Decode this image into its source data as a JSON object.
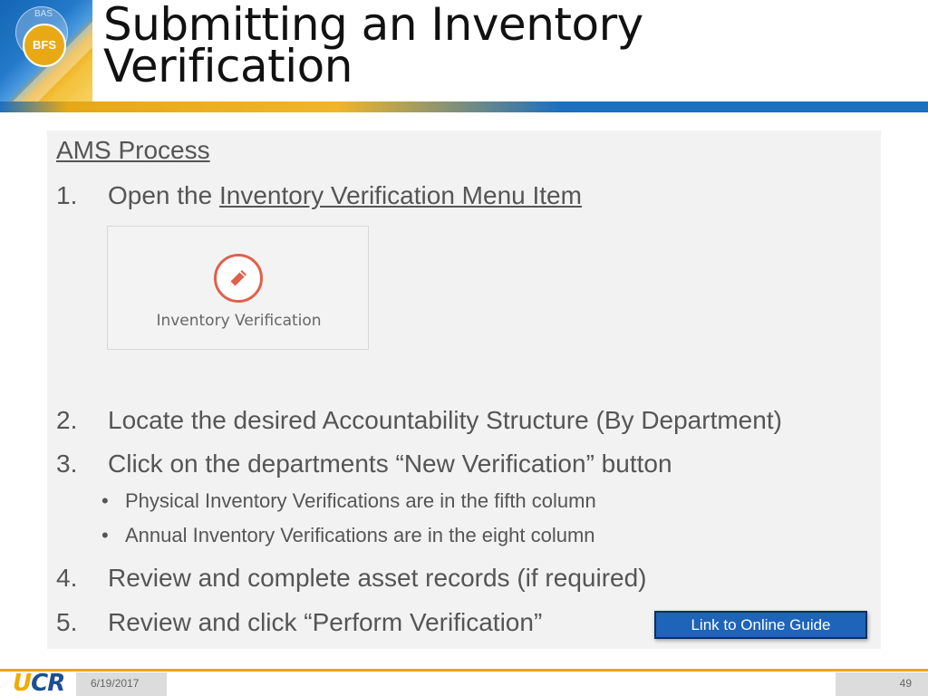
{
  "header": {
    "logo_small_text": "BAS",
    "logo_badge_text": "BFS",
    "title_line1": "Submitting an Inventory",
    "title_line2": "Verification"
  },
  "content": {
    "section_title": "AMS Process",
    "steps": [
      {
        "num": "1.",
        "text": "Open the ",
        "link": "Inventory Verification Menu Item"
      },
      {
        "num": "2.",
        "text": "Locate the desired Accountability Structure (By Department)"
      },
      {
        "num": "3.",
        "text": "Click on the departments “New Verification” button"
      },
      {
        "num": "4.",
        "text": "Review and complete asset records (if required)"
      },
      {
        "num": "5.",
        "text": "Review and click “Perform Verification”"
      }
    ],
    "bullets": [
      "Physical Inventory Verifications are in the fifth column",
      "Annual Inventory Verifications are in the eight column"
    ],
    "menu_item": {
      "icon": "pencil-icon",
      "label": "Inventory Verification"
    },
    "guide_button": "Link to Online Guide"
  },
  "footer": {
    "logo": "UCR",
    "date": "6/19/2017",
    "page_number": "49"
  },
  "colors": {
    "accent_blue": "#1d6fc0",
    "accent_gold": "#e6a817",
    "icon_red": "#e0604a",
    "button_blue": "#1e64b9"
  }
}
